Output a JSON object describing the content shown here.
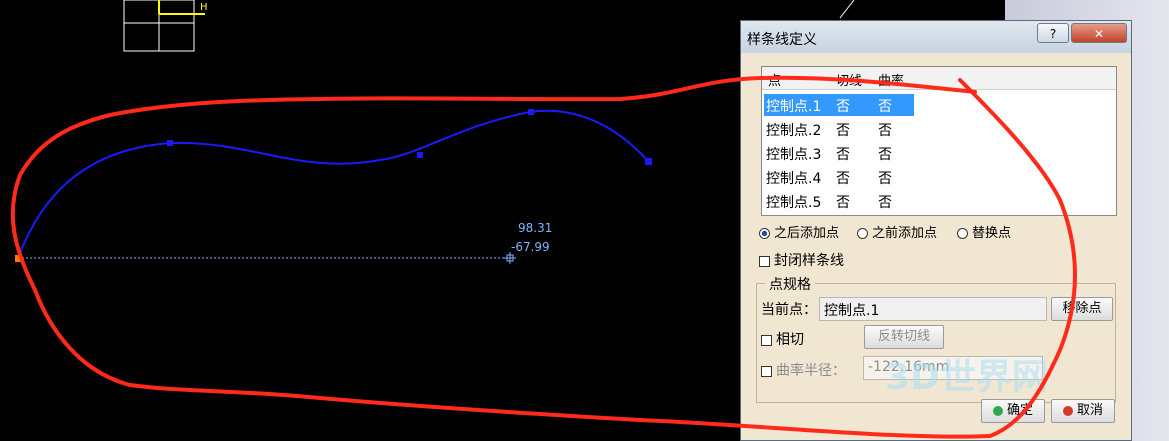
{
  "dialog": {
    "title": "样条线定义",
    "help_label": "?",
    "close_label": "✕",
    "list": {
      "columns": [
        "点",
        "切线",
        "曲率"
      ],
      "rows": [
        {
          "name": "控制点.1",
          "tangent": "否",
          "curvature": "否"
        },
        {
          "name": "控制点.2",
          "tangent": "否",
          "curvature": "否"
        },
        {
          "name": "控制点.3",
          "tangent": "否",
          "curvature": "否"
        },
        {
          "name": "控制点.4",
          "tangent": "否",
          "curvature": "否"
        },
        {
          "name": "控制点.5",
          "tangent": "否",
          "curvature": "否"
        }
      ],
      "selected_index": 0
    },
    "radios": {
      "after": "之后添加点",
      "before": "之前添加点",
      "replace": "替换点",
      "selected": "after"
    },
    "closed_spline_label": "封闭样条线",
    "point_spec": {
      "group_label": "点规格",
      "current_point_label": "当前点：",
      "current_point_value": "控制点.1",
      "remove_button": "移除点",
      "tangent_label": "相切",
      "reverse_tangent_button": "反转切线",
      "radius_label": "曲率半径：",
      "radius_value": "-122.16mm"
    },
    "ok_button": "确定",
    "cancel_button": "取消"
  },
  "viewport": {
    "coord_x": "98.31",
    "coord_y": "-67.99",
    "grid_marker": "H"
  },
  "watermark": "3D世界网",
  "colors": {
    "spline": "#1a1aff",
    "annotation": "#ff2a1a",
    "selection": "#3399ff",
    "dialog_bg": "#f0e6d2"
  }
}
